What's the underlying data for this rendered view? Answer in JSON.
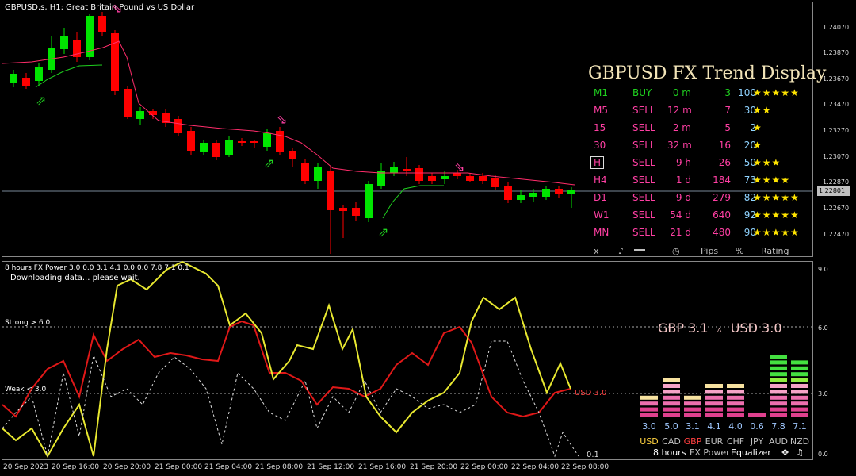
{
  "chart_header": "GBPUSD.s, H1:  Great Britain Pound vs US Dollar",
  "price_axis": [
    "1.24070",
    "1.23870",
    "1.23670",
    "1.23470",
    "1.23270",
    "1.23070",
    "1.22870",
    "1.22801",
    "1.22670",
    "1.22470"
  ],
  "current_price": "1.22801",
  "time_axis": [
    "20 Sep 2023",
    "20 Sep 16:00",
    "20 Sep 20:00",
    "21 Sep 00:00",
    "21 Sep 04:00",
    "21 Sep 08:00",
    "21 Sep 12:00",
    "21 Sep 16:00",
    "21 Sep 20:00",
    "22 Sep 00:00",
    "22 Sep 04:00",
    "22 Sep 08:00"
  ],
  "trend_display": {
    "title": "GBPUSD FX Trend Display",
    "rows": [
      {
        "tf": "M1",
        "signal": "BUY",
        "time": "0 m",
        "pips": "3",
        "pct": "100",
        "stars": "★★★★★",
        "color": "#1fd11f"
      },
      {
        "tf": "M5",
        "signal": "SELL",
        "time": "12 m",
        "pips": "7",
        "pct": "30",
        "stars": "★★",
        "color": "#ff3fa3"
      },
      {
        "tf": "15",
        "signal": "SELL",
        "time": "2 m",
        "pips": "5",
        "pct": "2",
        "stars": "★",
        "color": "#ff3fa3"
      },
      {
        "tf": "30",
        "signal": "SELL",
        "time": "32 m",
        "pips": "16",
        "pct": "20",
        "stars": "★",
        "color": "#ff3fa3"
      },
      {
        "tf": "H",
        "signal": "SELL",
        "time": "9 h",
        "pips": "26",
        "pct": "50",
        "stars": "★★★",
        "color": "#ff3fa3"
      },
      {
        "tf": "H4",
        "signal": "SELL",
        "time": "1 d",
        "pips": "184",
        "pct": "73",
        "stars": "★★★★",
        "color": "#ff3fa3"
      },
      {
        "tf": "D1",
        "signal": "SELL",
        "time": "9 d",
        "pips": "279",
        "pct": "82",
        "stars": "★★★★★",
        "color": "#ff3fa3"
      },
      {
        "tf": "W1",
        "signal": "SELL",
        "time": "54 d",
        "pips": "640",
        "pct": "92",
        "stars": "★★★★★",
        "color": "#ff3fa3"
      },
      {
        "tf": "MN",
        "signal": "SELL",
        "time": "21 d",
        "pips": "480",
        "pct": "90",
        "stars": "★★★★★",
        "color": "#ff3fa3"
      }
    ],
    "footer": {
      "close": "x",
      "music": "♪",
      "clock": "◷",
      "pips": "Pips",
      "pct": "%",
      "rating": "Rating"
    }
  },
  "power": {
    "header": "8 hours FX Power 3.0 0.0 3.1 4.1 0.0 0.0 7.8 7.1 0.1",
    "status": "Downloading data... please wait.",
    "strong_label": "Strong > 6.0",
    "weak_label": "Weak < 3.0",
    "pair_left": "GBP 3.1",
    "pair_arrow": "▵",
    "pair_right": "USD 3.0",
    "usd_tag": "USD 3.0",
    "gbp_tag": "GBP 3.1",
    "low_tag": "0.1",
    "axis": [
      "9.0",
      "6.0",
      "3.0",
      "0.0"
    ],
    "equalizer": {
      "values": [
        "3.0",
        "5.0",
        "3.1",
        "4.1",
        "4.0",
        "0.6",
        "7.8",
        "7.1"
      ],
      "currencies": [
        "USD",
        "CAD",
        "GBP",
        "EUR",
        "CHF",
        "JPY",
        "AUD",
        "NZD"
      ],
      "levels": [
        3.0,
        5.0,
        3.1,
        4.1,
        4.0,
        0.6,
        7.8,
        7.1
      ],
      "footer_hours": "8 hours",
      "footer_power": "FX Power",
      "footer_eq": "Equalizer"
    }
  },
  "colors": {
    "bull": "#00e600",
    "bear": "#ff0000",
    "ma": "#ff2d6b",
    "gbp_line": "#e01818",
    "usd_line": "#e8e830",
    "accent": "#f2e4b8"
  }
}
